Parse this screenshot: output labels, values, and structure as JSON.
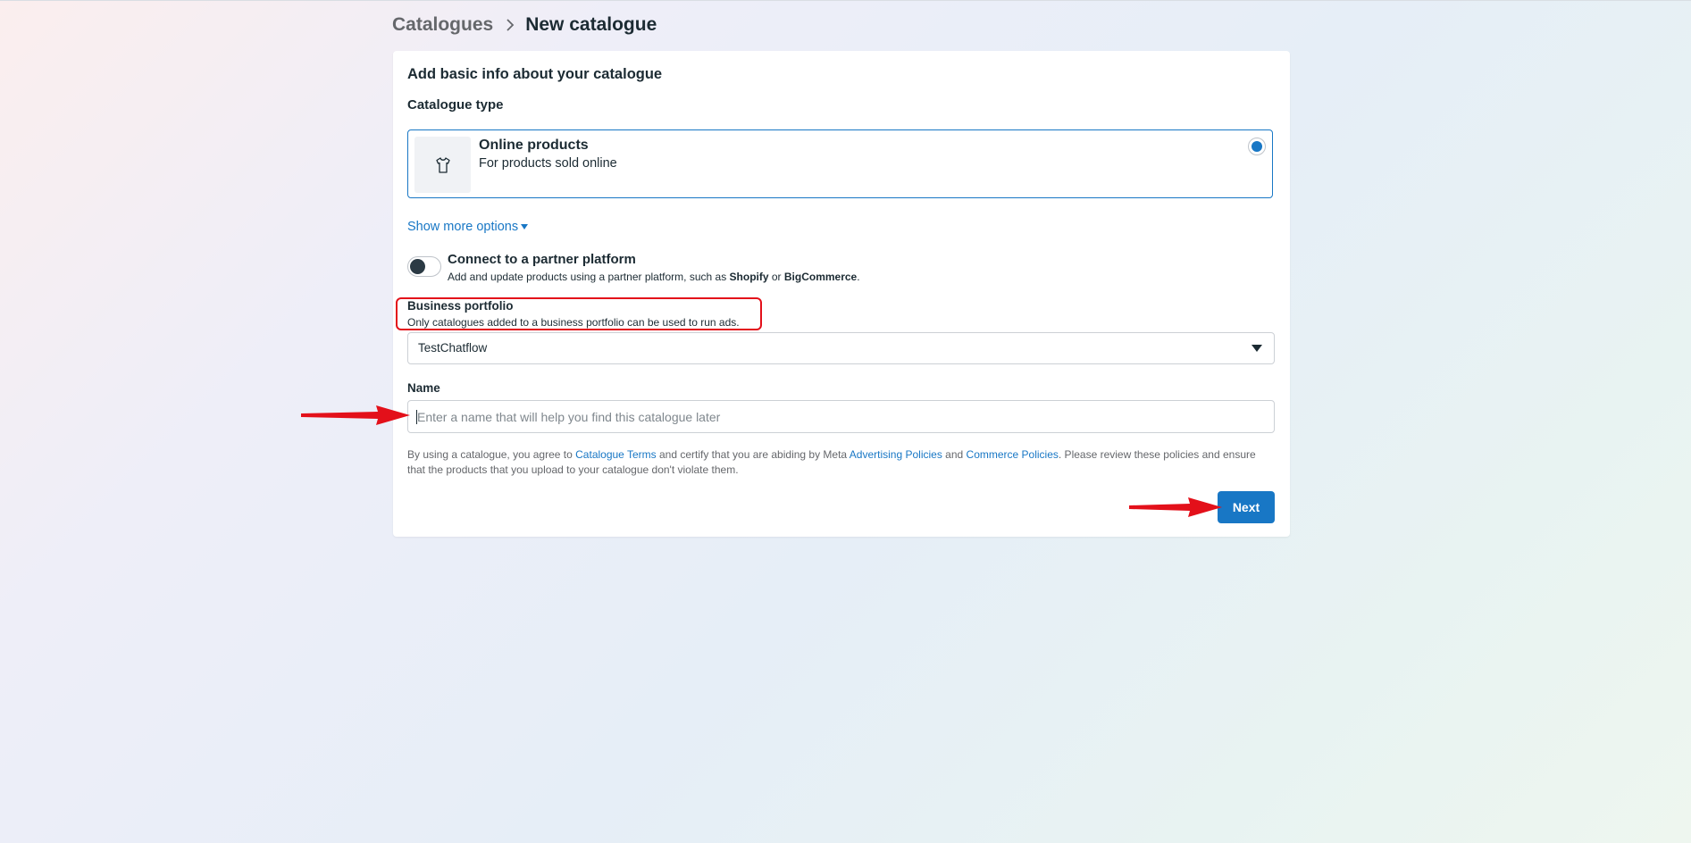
{
  "breadcrumb": {
    "parent": "Catalogues",
    "current": "New catalogue"
  },
  "card": {
    "title": "Add basic info about your catalogue",
    "catalogue_type_label": "Catalogue type",
    "catalogue_type_option": {
      "title": "Online products",
      "description": "For products sold online",
      "icon": "t-shirt-icon",
      "selected": true
    },
    "show_more_label": "Show more options",
    "partner": {
      "title": "Connect to a partner platform",
      "desc_prefix": "Add and update products using a partner platform, such as ",
      "platform_1": "Shopify",
      "desc_or": " or ",
      "platform_2": "BigCommerce",
      "desc_suffix": ".",
      "enabled": false
    },
    "business_portfolio": {
      "title": "Business portfolio",
      "description": "Only catalogues added to a business portfolio can be used to run ads.",
      "selected_value": "TestChatflow"
    },
    "name": {
      "label": "Name",
      "placeholder": "Enter a name that will help you find this catalogue later",
      "value": ""
    },
    "terms": {
      "t1": "By using a catalogue, you agree to ",
      "link_catalogue_terms": "Catalogue Terms",
      "t2": " and certify that you are abiding by Meta ",
      "link_advertising_policies": "Advertising Policies",
      "t3": " and ",
      "link_commerce_policies": "Commerce Policies",
      "t4": ". Please review these policies and ensure that the products that you upload to your catalogue don't violate them."
    },
    "next_label": "Next"
  },
  "colors": {
    "accent": "#1877c5",
    "annotation": "#e3101a",
    "text": "#1c2b33",
    "muted": "#65676b"
  }
}
